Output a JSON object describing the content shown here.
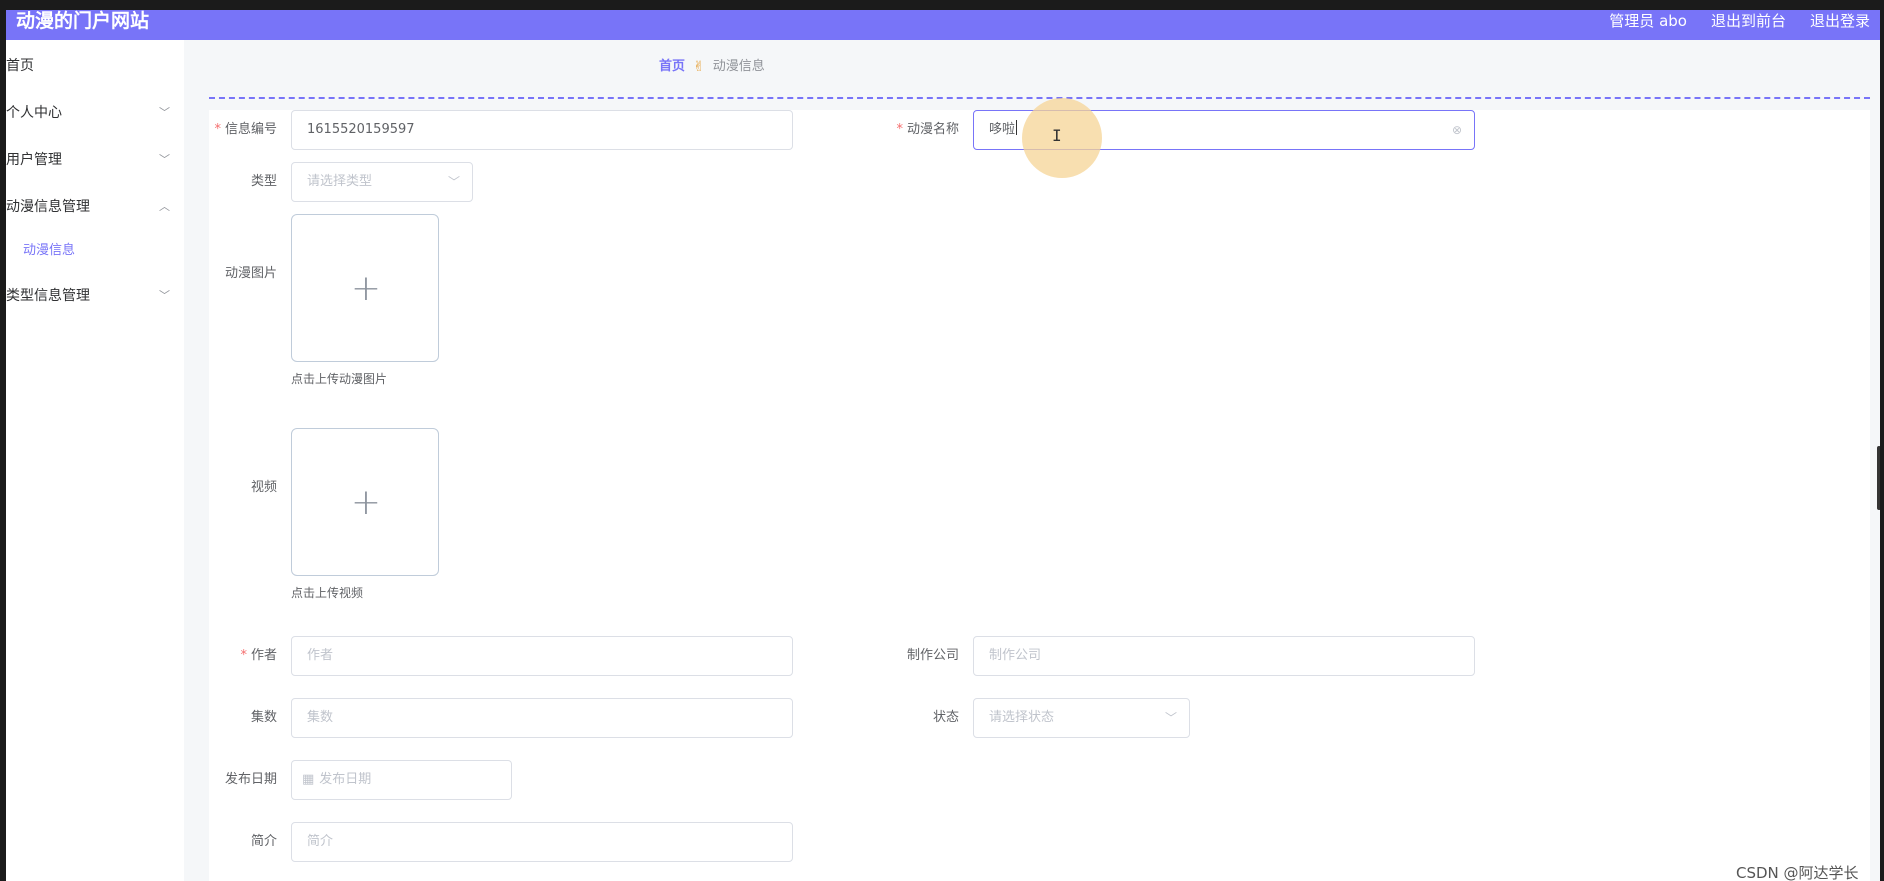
{
  "header": {
    "app_title": "动漫的门户网站",
    "user_label": "管理员 abo",
    "to_frontend": "退出到前台",
    "logout": "退出登录"
  },
  "sidebar": {
    "items": [
      {
        "label": "首页"
      },
      {
        "label": "个人中心",
        "chevron": "﹀"
      },
      {
        "label": "用户管理",
        "chevron": "﹀"
      },
      {
        "label": "动漫信息管理",
        "chevron": "︿"
      },
      {
        "label": "动漫信息"
      },
      {
        "label": "类型信息管理",
        "chevron": "﹀"
      }
    ]
  },
  "breadcrumb": {
    "home": "首页",
    "current": "动漫信息"
  },
  "form": {
    "info_no": {
      "label": "信息编号",
      "value": "1615520159597"
    },
    "anime_name": {
      "label": "动漫名称",
      "value": "哆啦"
    },
    "type": {
      "label": "类型",
      "placeholder": "请选择类型"
    },
    "image": {
      "label": "动漫图片",
      "tip": "点击上传动漫图片"
    },
    "video": {
      "label": "视频",
      "tip": "点击上传视频"
    },
    "author": {
      "label": "作者",
      "placeholder": "作者"
    },
    "company": {
      "label": "制作公司",
      "placeholder": "制作公司"
    },
    "episodes": {
      "label": "集数",
      "placeholder": "集数"
    },
    "status": {
      "label": "状态",
      "placeholder": "请选择状态"
    },
    "release_date": {
      "label": "发布日期",
      "placeholder": "发布日期"
    },
    "intro": {
      "label": "简介",
      "placeholder": "简介"
    }
  },
  "icons": {
    "clear": "⊗",
    "select_arrow": "﹀",
    "plus": "+",
    "calendar": "▦",
    "breadcrumb_sep": "✌"
  },
  "watermark": "CSDN @阿达学长",
  "colors": {
    "accent": "#7874f8",
    "required": "#f56c6c"
  }
}
